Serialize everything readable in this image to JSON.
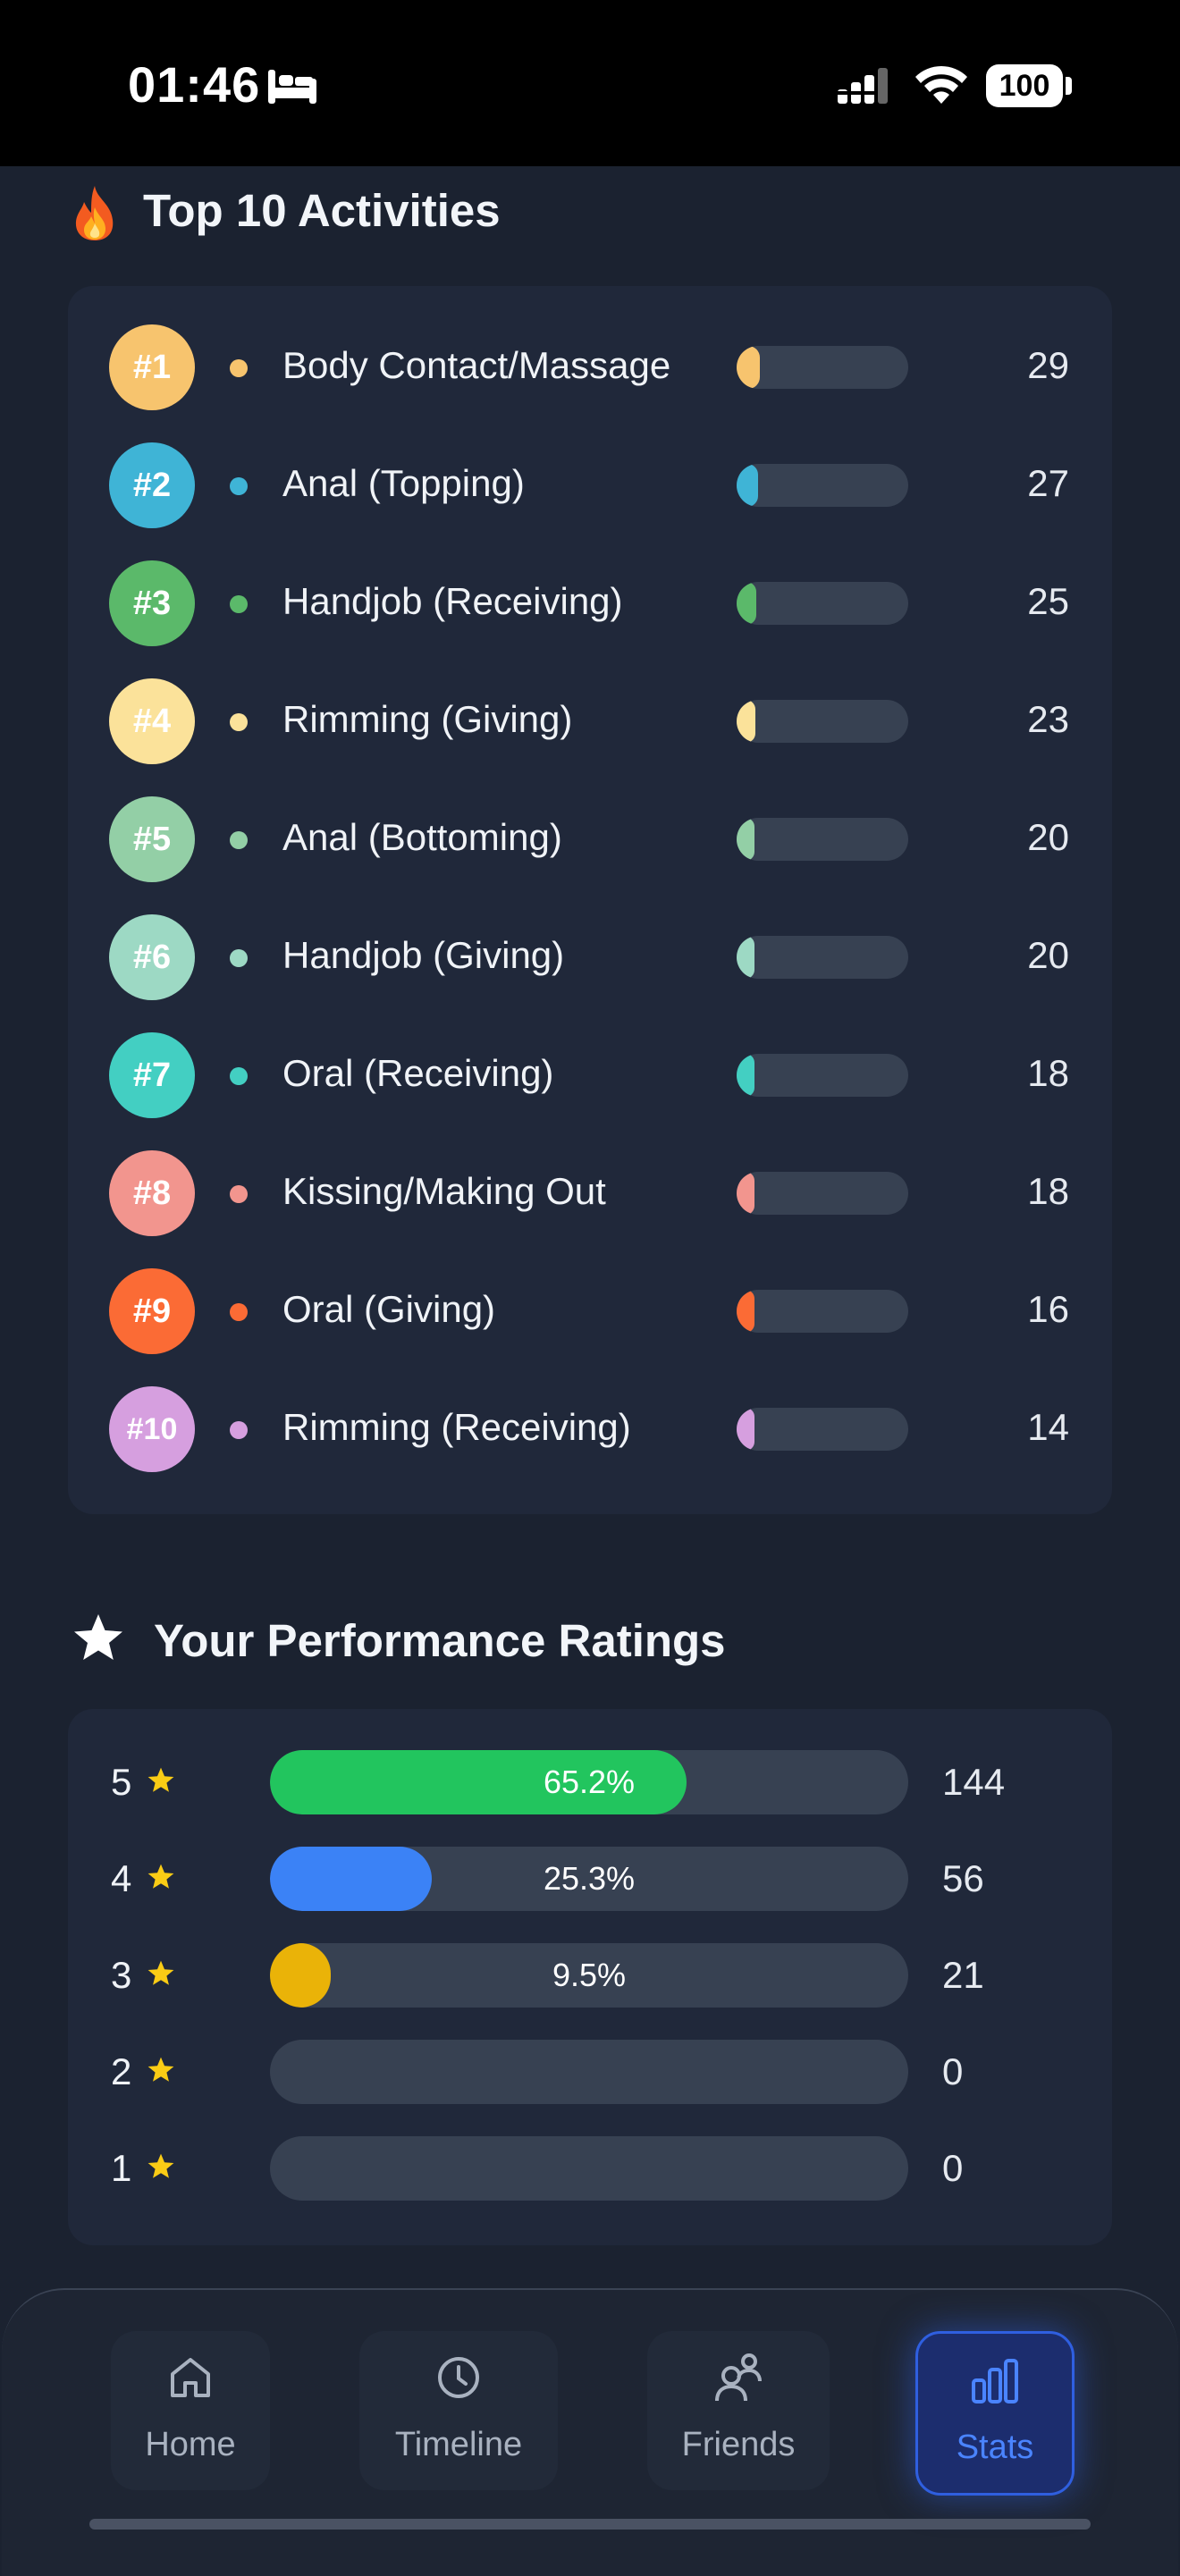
{
  "status_bar": {
    "time": "01:46",
    "battery": "100"
  },
  "top_activities": {
    "title": "Top 10 Activities",
    "items": [
      {
        "rank": "#1",
        "label": "Body Contact/Massage",
        "count": "29",
        "color": "#f7c46e"
      },
      {
        "rank": "#2",
        "label": "Anal (Topping)",
        "count": "27",
        "color": "#3fb4d6"
      },
      {
        "rank": "#3",
        "label": "Handjob (Receiving)",
        "count": "25",
        "color": "#5bb96a"
      },
      {
        "rank": "#4",
        "label": "Rimming (Giving)",
        "count": "23",
        "color": "#fbe29a"
      },
      {
        "rank": "#5",
        "label": "Anal (Bottoming)",
        "count": "20",
        "color": "#93cfa6"
      },
      {
        "rank": "#6",
        "label": "Handjob (Giving)",
        "count": "20",
        "color": "#9dd9c4"
      },
      {
        "rank": "#7",
        "label": "Oral (Receiving)",
        "count": "18",
        "color": "#43cfc2"
      },
      {
        "rank": "#8",
        "label": "Kissing/Making Out",
        "count": "18",
        "color": "#f2958e"
      },
      {
        "rank": "#9",
        "label": "Oral (Giving)",
        "count": "16",
        "color": "#fb6b35"
      },
      {
        "rank": "#10",
        "label": "Rimming (Receiving)",
        "count": "14",
        "color": "#d69fdf"
      }
    ]
  },
  "ratings": {
    "title": "Your Performance Ratings",
    "rows": [
      {
        "stars": "5",
        "percent_label": "65.2%",
        "fraction": 0.652,
        "count": "144",
        "color": "#22c55e"
      },
      {
        "stars": "4",
        "percent_label": "25.3%",
        "fraction": 0.253,
        "count": "56",
        "color": "#3b82f6"
      },
      {
        "stars": "3",
        "percent_label": "9.5%",
        "fraction": 0.095,
        "count": "21",
        "color": "#eab308"
      },
      {
        "stars": "2",
        "percent_label": "",
        "fraction": 0,
        "count": "0",
        "color": "#374152"
      },
      {
        "stars": "1",
        "percent_label": "",
        "fraction": 0,
        "count": "0",
        "color": "#374152"
      }
    ]
  },
  "nav": {
    "items": [
      {
        "label": "Home",
        "icon": "home-icon"
      },
      {
        "label": "Timeline",
        "icon": "clock-icon"
      },
      {
        "label": "Friends",
        "icon": "friends-icon"
      },
      {
        "label": "Stats",
        "icon": "bar-chart-icon",
        "active": true
      }
    ]
  }
}
